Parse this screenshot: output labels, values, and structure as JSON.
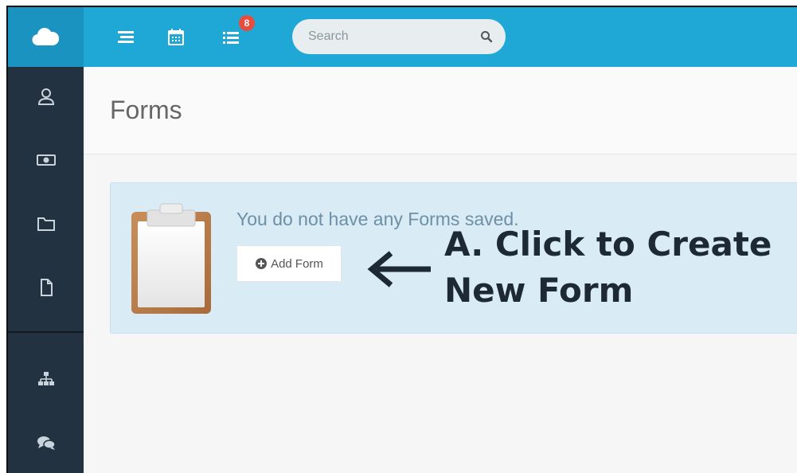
{
  "topbar": {
    "search_placeholder": "Search",
    "notification_count": "8",
    "icons": [
      "list-icon",
      "calendar-icon",
      "tasks-icon",
      "search-icon"
    ]
  },
  "sidebar": {
    "items": [
      "user-icon",
      "money-icon",
      "folder-icon",
      "file-icon",
      "sitemap-icon",
      "comments-icon"
    ]
  },
  "page": {
    "title": "Forms"
  },
  "empty_state": {
    "message": "You do not have any Forms saved.",
    "add_button_label": "Add Form"
  },
  "annotation": {
    "line1": "A. Click to Create",
    "line2": "New Form"
  },
  "colors": {
    "topbar": "#1fa8d6",
    "sidebar": "#233240",
    "panel": "#d9ecf5",
    "badge": "#e84c3d"
  }
}
